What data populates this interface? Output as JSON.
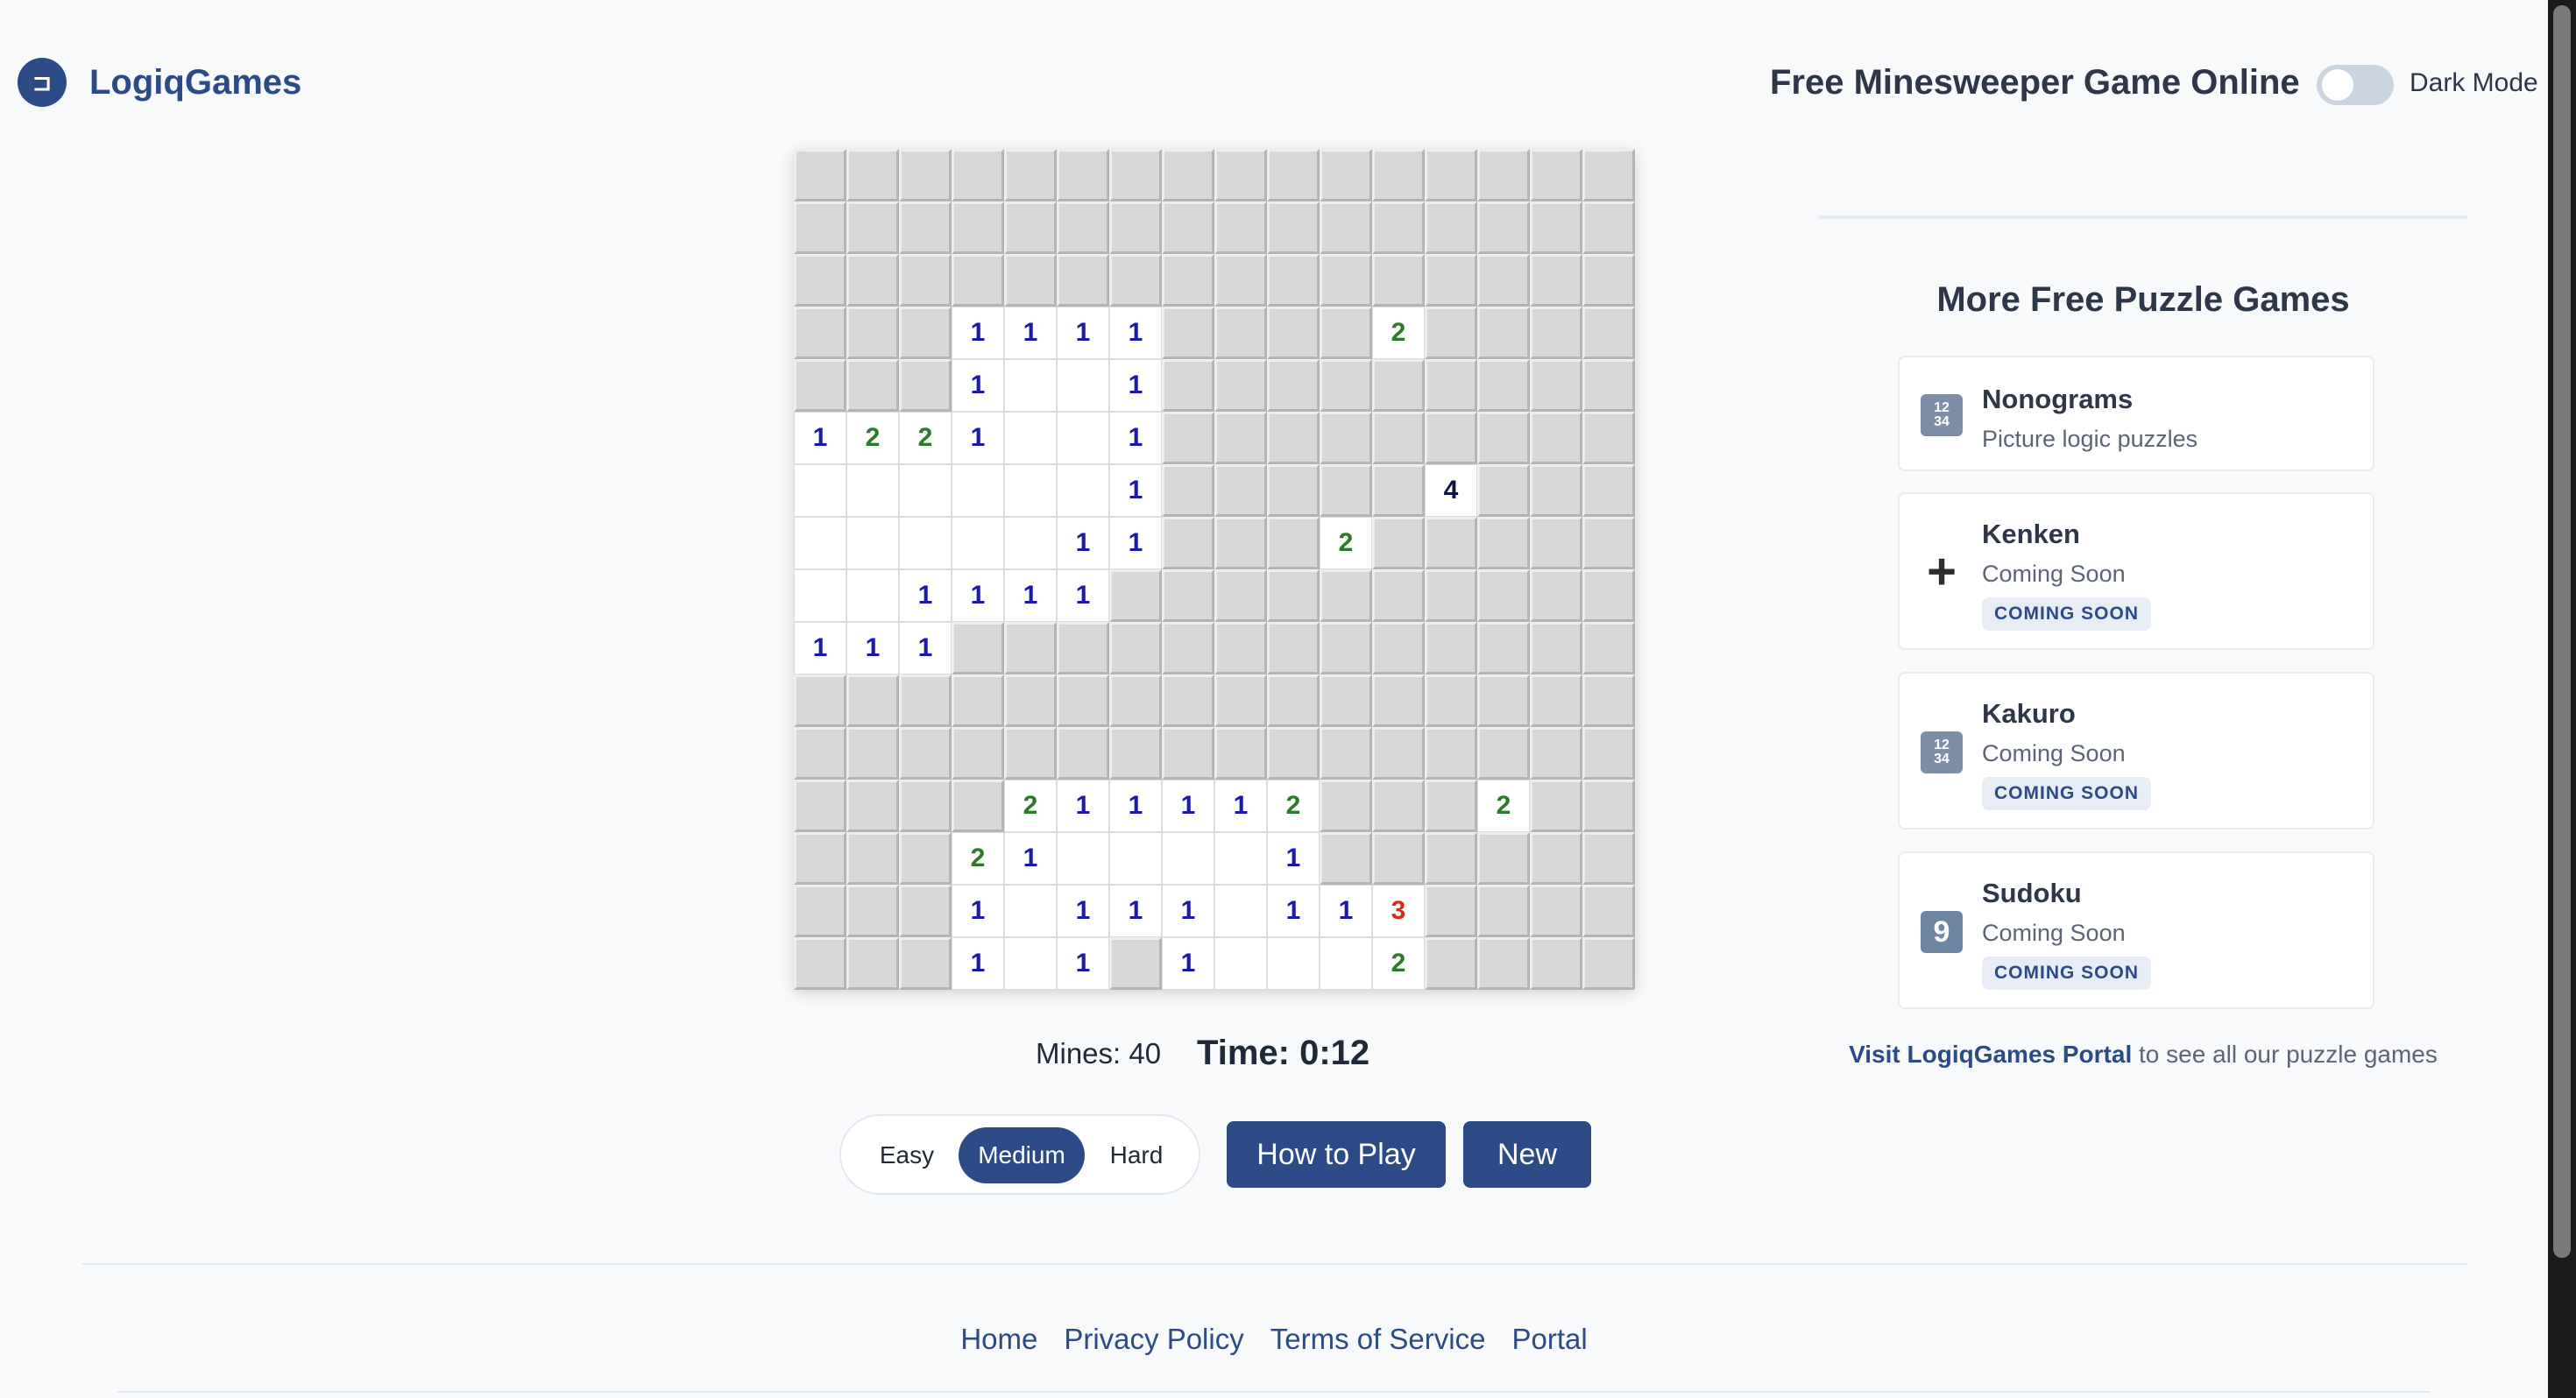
{
  "header": {
    "logo_text": "LogiqGames",
    "logo_icon": "logo-icon",
    "title": "Free Minesweeper Game Online",
    "dark_mode_label": "Dark Mode",
    "dark_mode_on": false
  },
  "board": {
    "rows": [
      "################",
      "################",
      "################",
      "###1111####2####",
      "###1  1#########",
      "1221  1#########",
      "      1#####4###",
      "     11###2#####",
      "  1111##########",
      "111#############",
      "################",
      "################",
      "####211112###2##",
      "###21    1######",
      "###1 111 113####",
      "###1 1#1   2####"
    ],
    "legend": "# = unrevealed cell, space = revealed empty cell, digit = adjacent mine count"
  },
  "status": {
    "mines": "Mines: 40",
    "time": "Time: 0:12"
  },
  "difficulty": {
    "options": [
      "Easy",
      "Medium",
      "Hard"
    ],
    "selected": "Medium"
  },
  "buttons": {
    "how_to_play": "How to Play",
    "new_game": "New"
  },
  "sidebar": {
    "heading": "More Free Puzzle Games",
    "games": [
      {
        "title": "Nonograms",
        "subtitle": "Picture logic puzzles",
        "badge": "",
        "icon": "number-grid-icon"
      },
      {
        "title": "Kenken",
        "subtitle": "Coming Soon",
        "badge": "COMING SOON",
        "icon": "plus-icon"
      },
      {
        "title": "Kakuro",
        "subtitle": "Coming Soon",
        "badge": "COMING SOON",
        "icon": "number-grid-icon"
      },
      {
        "title": "Sudoku",
        "subtitle": "Coming Soon",
        "badge": "COMING SOON",
        "icon": "nine-keycap-icon"
      }
    ],
    "portal_link": "Visit LogiqGames Portal",
    "portal_text": " to see all our puzzle games"
  },
  "footer": {
    "links": [
      "Home",
      "Privacy Policy",
      "Terms of Service",
      "Portal"
    ]
  },
  "colors": {
    "brand": "#2c4a86",
    "number_1": "#1a1aa6",
    "number_2": "#2a7a2a",
    "number_3": "#d42a1a",
    "number_4": "#10104a"
  }
}
